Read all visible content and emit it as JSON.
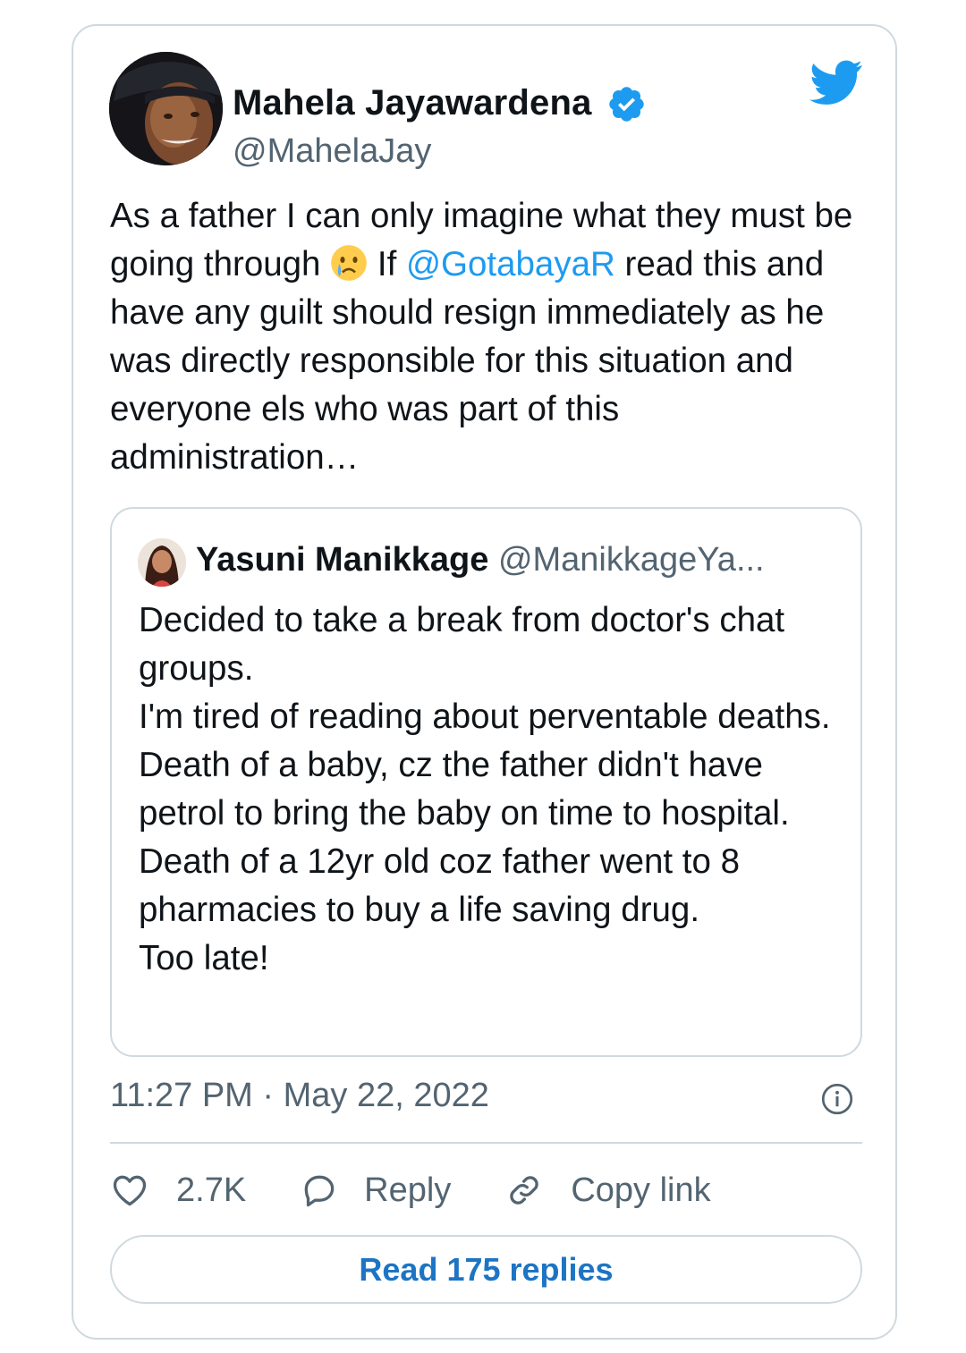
{
  "tweet": {
    "author_name": "Mahela Jayawardena",
    "author_handle": "@MahelaJay",
    "text_part1": "As a father I can only imagine what they must be going through ",
    "text_part2": " If ",
    "mention": "@GotabayaR",
    "text_part3": " read this and have any guilt should resign immediately as he was directly responsible for this situation and everyone els who was part of this administration…",
    "timestamp": "11:27 PM · May 22, 2022"
  },
  "quoted": {
    "author_name": "Yasuni Manikkage",
    "author_handle": "@ManikkageYa...",
    "text": "Decided to take a break from doctor's chat groups.\nI'm tired of reading about perventable deaths.\nDeath of a baby, cz the father didn't have petrol to bring the baby on time to hospital.\nDeath of a 12yr old coz father went to 8 pharmacies to buy a life saving drug.\nToo late!"
  },
  "actions": {
    "likes": "2.7K",
    "reply_label": "Reply",
    "copy_label": "Copy link"
  },
  "read_replies_label": "Read 175 replies",
  "icons": {
    "brand": "twitter-bird-icon",
    "verified": "verified-badge-icon",
    "emoji": "crying-face-emoji",
    "info": "info-icon",
    "like": "heart-icon",
    "reply": "speech-bubble-icon",
    "copy": "link-icon"
  },
  "colors": {
    "accent": "#1d9bf0",
    "secondary_text": "#536471",
    "border": "#cfd9de",
    "button_text": "#1d74c4"
  }
}
